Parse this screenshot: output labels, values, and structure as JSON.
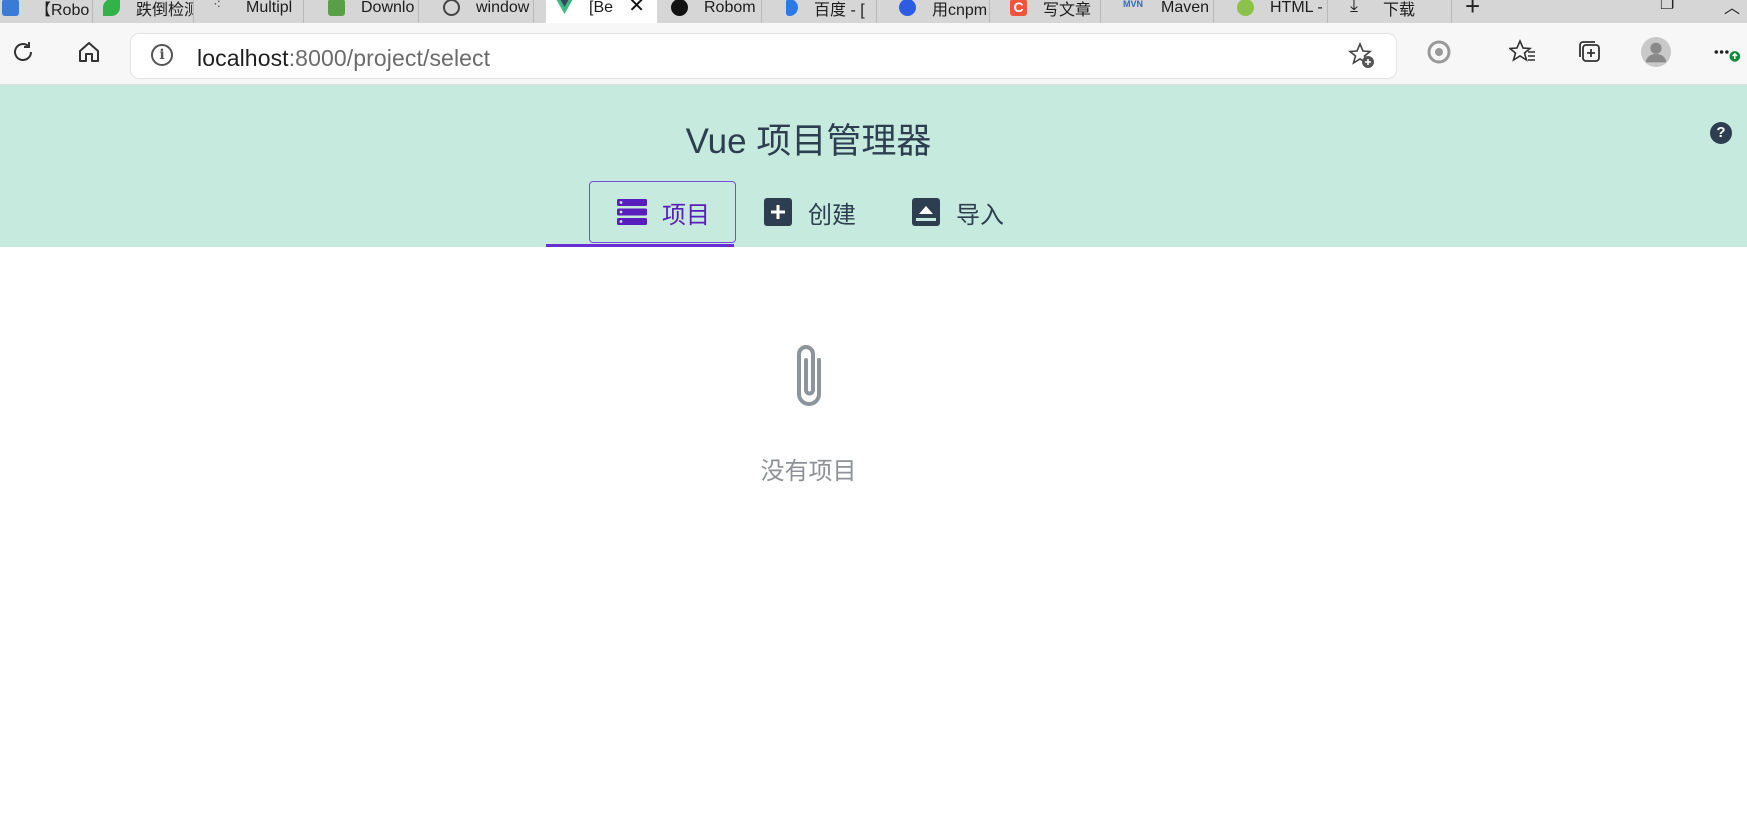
{
  "browser": {
    "tabs": [
      {
        "label": "【Robo",
        "icon": "edge-page-icon",
        "color": "#3a7bd5"
      },
      {
        "label": "跌倒检测",
        "icon": "leaf-icon",
        "color": "#32b34a"
      },
      {
        "label": "Multipl",
        "icon": "dots-icon",
        "color": "#555555"
      },
      {
        "label": "Downlo",
        "icon": "cube-icon",
        "color": "#5a9e47"
      },
      {
        "label": "window",
        "icon": "search-page-icon",
        "color": "#444444"
      },
      {
        "label": "[Be",
        "icon": "vue-icon",
        "color": "#41b883",
        "active": true
      },
      {
        "label": "Robom",
        "icon": "github-icon",
        "color": "#111111"
      },
      {
        "label": "百度 - [",
        "icon": "bing-icon",
        "color": "#2a7ae2"
      },
      {
        "label": "用cnpm",
        "icon": "baidu-icon",
        "color": "#2d5be3"
      },
      {
        "label": "写文章",
        "icon": "csdn-icon",
        "color": "#f0543b"
      },
      {
        "label": "Maven",
        "icon": "mvn-icon",
        "color": "#2d6cc0"
      },
      {
        "label": "HTML -",
        "icon": "html-icon",
        "color": "#8bc34a"
      },
      {
        "label": "下载",
        "icon": "download-icon",
        "color": "#222222"
      }
    ],
    "close_glyph": "✕",
    "new_tab_glyph": "+",
    "url": {
      "host": "localhost",
      "path": ":8000/project/select"
    }
  },
  "app": {
    "title": "Vue 项目管理器",
    "help_glyph": "?",
    "nav": [
      {
        "label": "项目",
        "icon": "server-list-icon",
        "active": true
      },
      {
        "label": "创建",
        "icon": "plus-square-icon",
        "active": false
      },
      {
        "label": "导入",
        "icon": "upload-box-icon",
        "active": false
      }
    ],
    "empty": {
      "icon": "paperclip-icon",
      "text": "没有项目"
    }
  },
  "colors": {
    "header_bg": "#c6eade",
    "accent": "#6a2fd3",
    "text": "#2c3e50",
    "muted": "#8e9196"
  }
}
